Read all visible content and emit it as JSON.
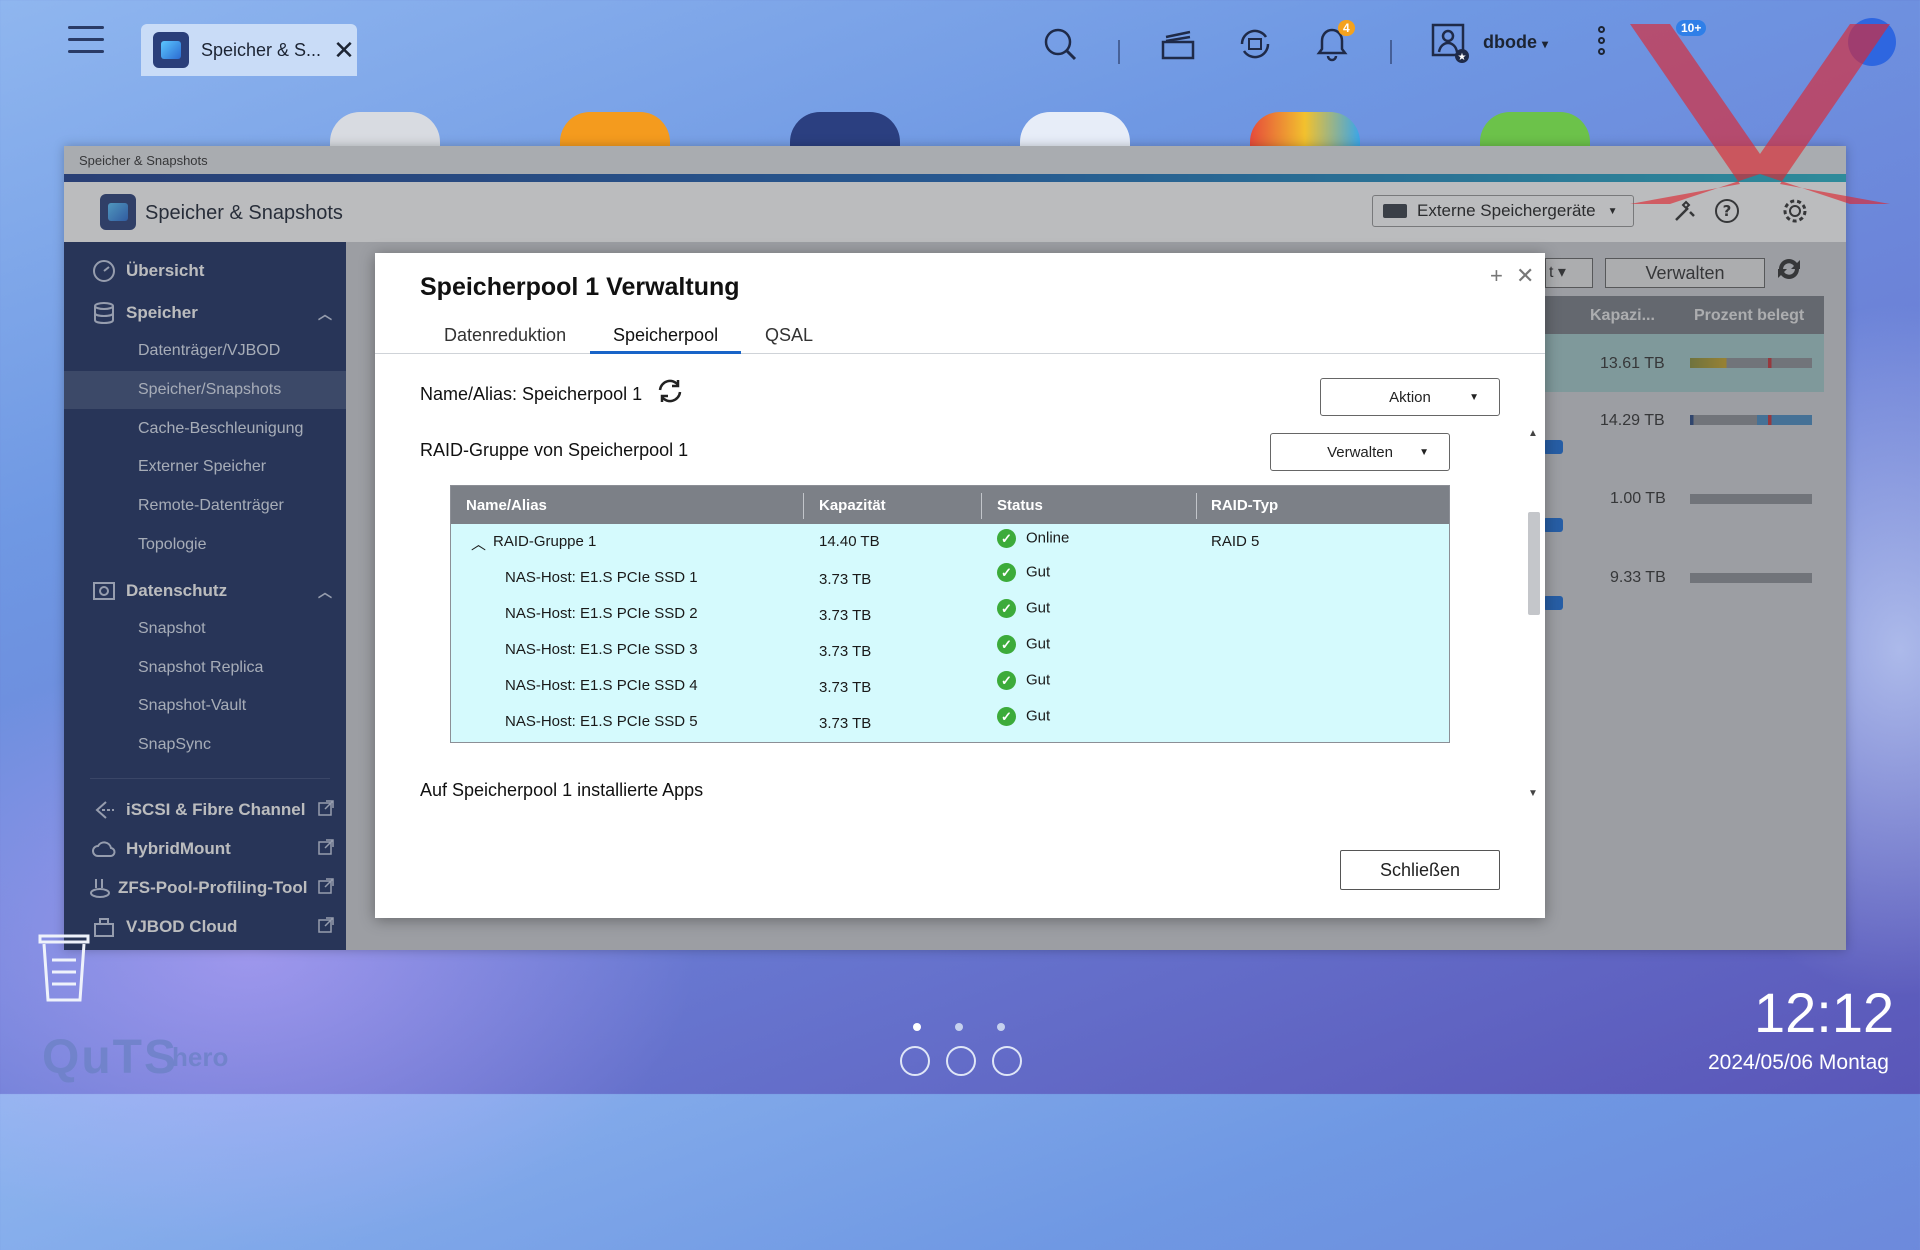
{
  "taskbar": {
    "app_tab_label": "Speicher & S...",
    "notification_count": "4",
    "more_badge": "10+",
    "user_name": "dbode"
  },
  "window": {
    "titlebar": "Speicher & Snapshots",
    "app_title": "Speicher & Snapshots",
    "ext_storage_label": "Externe Speichergeräte",
    "bg_manage_label": "Verwalten",
    "bg_cols": [
      "Kapazi...",
      "Prozent belegt"
    ],
    "bg_capacities": [
      "13.61 TB",
      "14.29 TB",
      "1.00 TB",
      "9.33 TB"
    ]
  },
  "sidebar": {
    "overview": "Übersicht",
    "storage": "Speicher",
    "storage_items": [
      "Datenträger/VJBOD",
      "Speicher/Snapshots",
      "Cache-Beschleunigung",
      "Externer Speicher",
      "Remote-Datenträger",
      "Topologie"
    ],
    "protection": "Datenschutz",
    "protection_items": [
      "Snapshot",
      "Snapshot Replica",
      "Snapshot-Vault",
      "SnapSync"
    ],
    "extras": [
      "iSCSI & Fibre Channel",
      "HybridMount",
      "ZFS-Pool-Profiling-Tool",
      "VJBOD Cloud"
    ]
  },
  "modal": {
    "title": "Speicherpool 1 Verwaltung",
    "tabs": [
      "Datenreduktion",
      "Speicherpool",
      "QSAL"
    ],
    "name_alias": "Name/Alias: Speicherpool 1",
    "action_button": "Aktion",
    "raid_group_title": "RAID-Gruppe von Speicherpool 1",
    "manage_button": "Verwalten",
    "table": {
      "headers": [
        "Name/Alias",
        "Kapazität",
        "Status",
        "RAID-Typ"
      ],
      "group": {
        "name": "RAID-Gruppe 1",
        "capacity": "14.40 TB",
        "status": "Online",
        "raid": "RAID 5"
      },
      "disks": [
        {
          "name": "NAS-Host: E1.S PCIe SSD 1",
          "capacity": "3.73 TB",
          "status": "Gut"
        },
        {
          "name": "NAS-Host: E1.S PCIe SSD 2",
          "capacity": "3.73 TB",
          "status": "Gut"
        },
        {
          "name": "NAS-Host: E1.S PCIe SSD 3",
          "capacity": "3.73 TB",
          "status": "Gut"
        },
        {
          "name": "NAS-Host: E1.S PCIe SSD 4",
          "capacity": "3.73 TB",
          "status": "Gut"
        },
        {
          "name": "NAS-Host: E1.S PCIe SSD 5",
          "capacity": "3.73 TB",
          "status": "Gut"
        }
      ]
    },
    "apps_title": "Auf Speicherpool 1 installierte Apps",
    "close_button": "Schließen"
  },
  "desktop": {
    "brand": "QuTS",
    "brand_suffix": "hero",
    "time": "12:12",
    "date": "2024/05/06 Montag"
  },
  "colors": {
    "sidebar_bg": "#1e3163",
    "table_row_bg": "#d5fafd",
    "accent_blue": "#1864c8",
    "ok_green": "#3cab3a"
  }
}
